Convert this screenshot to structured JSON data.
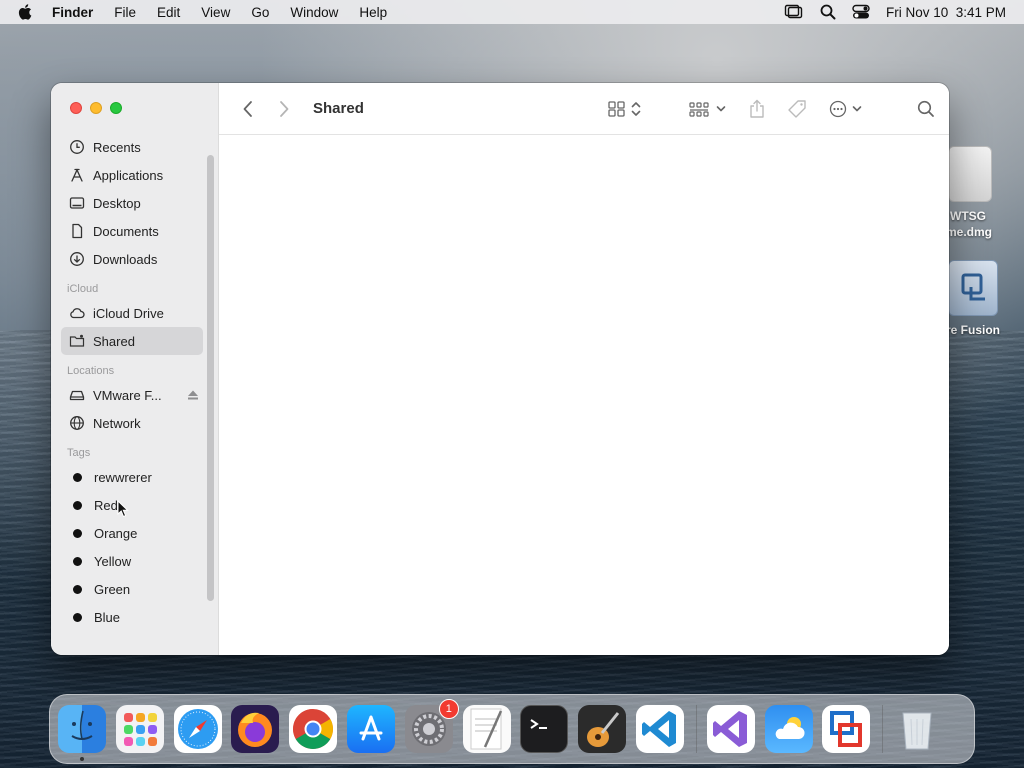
{
  "menubar": {
    "app_name": "Finder",
    "items": [
      "File",
      "Edit",
      "View",
      "Go",
      "Window",
      "Help"
    ],
    "datetime": "Fri Nov 10  3:41 PM"
  },
  "desktop": {
    "icons": [
      {
        "label_line1": "WTSG",
        "label_line2": "me.dmg",
        "icon": "dmg-file-icon"
      },
      {
        "label_line1": "re Fusion",
        "icon": "vmware-fusion-volume-icon"
      }
    ]
  },
  "window": {
    "title": "Shared",
    "sidebar": {
      "favorites": [
        {
          "label": "Recents",
          "icon": "clock-icon"
        },
        {
          "label": "Applications",
          "icon": "applications-icon"
        },
        {
          "label": "Desktop",
          "icon": "desktop-icon"
        },
        {
          "label": "Documents",
          "icon": "document-icon"
        },
        {
          "label": "Downloads",
          "icon": "download-icon"
        }
      ],
      "icloud_header": "iCloud",
      "icloud": [
        {
          "label": "iCloud Drive",
          "icon": "cloud-icon"
        },
        {
          "label": "Shared",
          "icon": "shared-folder-icon",
          "selected": true
        }
      ],
      "locations_header": "Locations",
      "locations": [
        {
          "label": "VMware F...",
          "icon": "drive-icon",
          "ejectable": true
        },
        {
          "label": "Network",
          "icon": "globe-icon"
        }
      ],
      "tags_header": "Tags",
      "tags": [
        {
          "label": "rewwrerer",
          "color": "#111111"
        },
        {
          "label": "Red",
          "color": "#111111"
        },
        {
          "label": "Orange",
          "color": "#111111"
        },
        {
          "label": "Yellow",
          "color": "#111111"
        },
        {
          "label": "Green",
          "color": "#111111"
        },
        {
          "label": "Blue",
          "color": "#111111"
        }
      ]
    },
    "toolbar": {
      "icons": [
        "back-icon",
        "forward-icon",
        "icon-view-icon",
        "group-icon",
        "share-icon",
        "tag-icon",
        "more-actions-icon",
        "search-icon"
      ]
    }
  },
  "dock": {
    "apps": [
      {
        "name": "Finder",
        "running": true
      },
      {
        "name": "Launchpad"
      },
      {
        "name": "Safari"
      },
      {
        "name": "Firefox"
      },
      {
        "name": "Chrome"
      },
      {
        "name": "App Store"
      },
      {
        "name": "System Settings",
        "badge": "1"
      },
      {
        "name": "TextEdit"
      },
      {
        "name": "Terminal"
      },
      {
        "name": "GarageBand"
      },
      {
        "name": "Visual Studio Code"
      },
      {
        "name": "Visual Studio"
      },
      {
        "name": "Weather"
      },
      {
        "name": "VMware Fusion"
      },
      {
        "name": "Trash"
      }
    ]
  }
}
